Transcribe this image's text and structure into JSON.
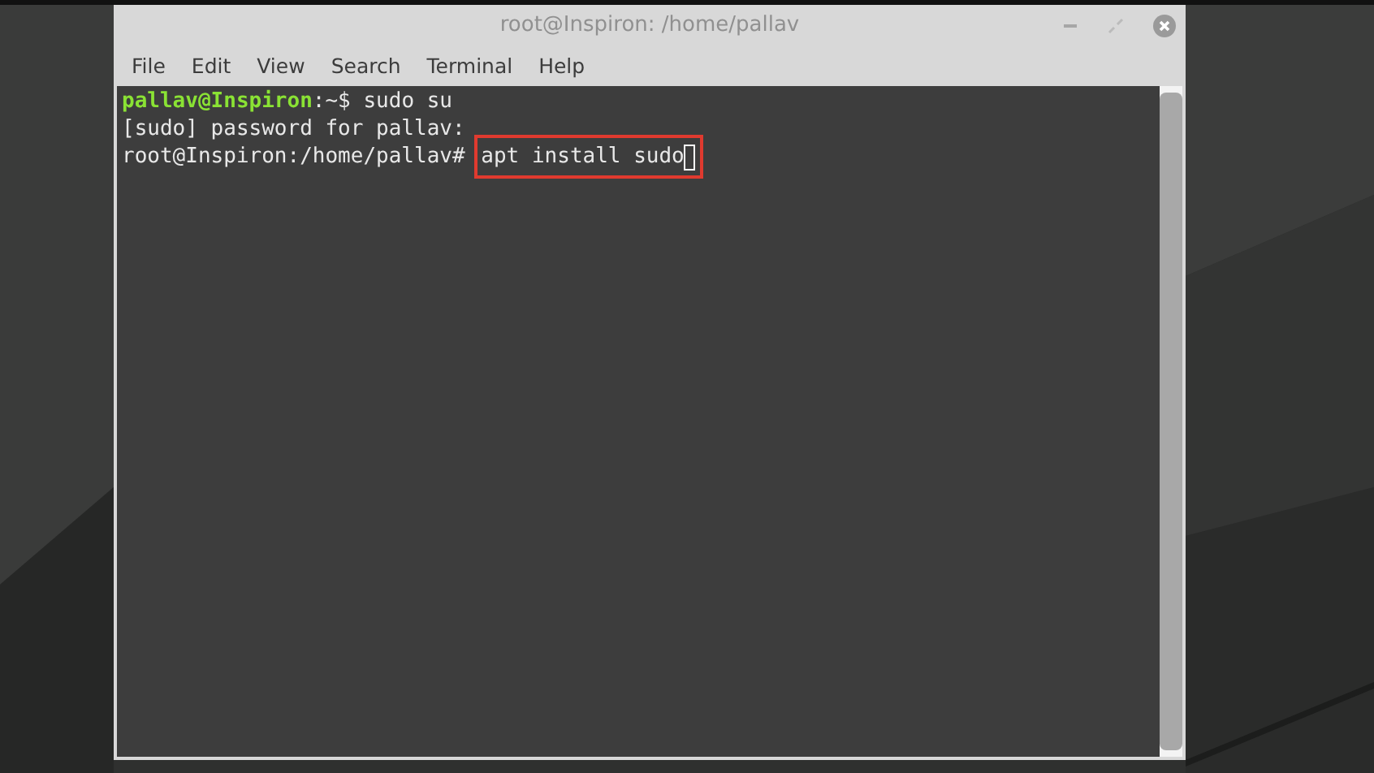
{
  "window": {
    "title": "root@Inspiron: /home/pallav"
  },
  "menu": [
    "File",
    "Edit",
    "View",
    "Search",
    "Terminal",
    "Help"
  ],
  "terminal": {
    "lines": [
      {
        "prompt": "pallav@Inspiron",
        "text": ":~$ sudo su"
      },
      {
        "text": "[sudo] password for pallav:"
      },
      {
        "text": "root@Inspiron:/home/pallav# ",
        "command": "apt install sudo",
        "highlighted": true,
        "cursor": true
      }
    ]
  }
}
